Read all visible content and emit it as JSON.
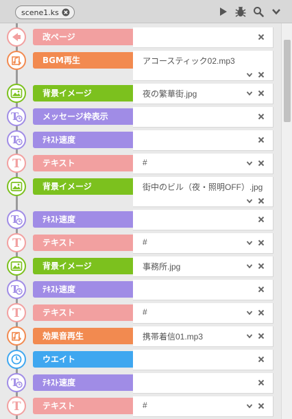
{
  "toolbar": {
    "tab_label": "scene1.ks",
    "icons": [
      "close-icon",
      "play-icon",
      "bug-icon",
      "search-icon",
      "chevron-down-icon"
    ]
  },
  "colors": {
    "pink": "#f2a0a0",
    "orange": "#f28a50",
    "green": "#7cc11e",
    "purple": "#a08ce6",
    "blue": "#3fa7f0"
  },
  "commands": [
    {
      "kind": "return",
      "icon": "return-arrow-icon",
      "color": "#f2a0a0",
      "label": "改ページ",
      "value": "",
      "has_dropdown": false
    },
    {
      "kind": "bgm",
      "icon": "bgm-play-icon",
      "color": "#f28a50",
      "label": "BGM再生",
      "value": "アコースティック02.mp3",
      "has_dropdown": true,
      "tall": true
    },
    {
      "kind": "bg",
      "icon": "background-image-icon",
      "color": "#7cc11e",
      "label": "背景イメージ",
      "value": "夜の繁華街.jpg",
      "has_dropdown": true
    },
    {
      "kind": "msgframe",
      "icon": "message-frame-icon",
      "color": "#a08ce6",
      "label": "メッセージ枠表示",
      "value": "",
      "has_dropdown": false
    },
    {
      "kind": "speed",
      "icon": "text-speed-icon",
      "color": "#a08ce6",
      "label": "ﾃｷｽﾄ速度",
      "value": "",
      "has_dropdown": false
    },
    {
      "kind": "text",
      "icon": "text-icon",
      "color": "#f2a0a0",
      "label": "テキスト",
      "value": "#",
      "has_dropdown": true
    },
    {
      "kind": "bg",
      "icon": "background-image-icon",
      "color": "#7cc11e",
      "label": "背景イメージ",
      "value": "街中のビル（夜・照明OFF）.jpg",
      "has_dropdown": true,
      "tall": true
    },
    {
      "kind": "speed",
      "icon": "text-speed-icon",
      "color": "#a08ce6",
      "label": "ﾃｷｽﾄ速度",
      "value": "",
      "has_dropdown": false
    },
    {
      "kind": "text",
      "icon": "text-icon",
      "color": "#f2a0a0",
      "label": "テキスト",
      "value": "#",
      "has_dropdown": true
    },
    {
      "kind": "bg",
      "icon": "background-image-icon",
      "color": "#7cc11e",
      "label": "背景イメージ",
      "value": "事務所.jpg",
      "has_dropdown": true
    },
    {
      "kind": "speed",
      "icon": "text-speed-icon",
      "color": "#a08ce6",
      "label": "ﾃｷｽﾄ速度",
      "value": "",
      "has_dropdown": false
    },
    {
      "kind": "text",
      "icon": "text-icon",
      "color": "#f2a0a0",
      "label": "テキスト",
      "value": "#",
      "has_dropdown": true
    },
    {
      "kind": "se",
      "icon": "sound-effect-icon",
      "color": "#f28a50",
      "label": "効果音再生",
      "value": "携帯着信01.mp3",
      "has_dropdown": true
    },
    {
      "kind": "wait",
      "icon": "clock-icon",
      "color": "#3fa7f0",
      "label": "ウエイト",
      "value": "",
      "has_dropdown": false
    },
    {
      "kind": "speed",
      "icon": "text-speed-icon",
      "color": "#a08ce6",
      "label": "ﾃｷｽﾄ速度",
      "value": "",
      "has_dropdown": false
    },
    {
      "kind": "text",
      "icon": "text-icon",
      "color": "#f2a0a0",
      "label": "テキスト",
      "value": "#",
      "has_dropdown": true
    }
  ]
}
